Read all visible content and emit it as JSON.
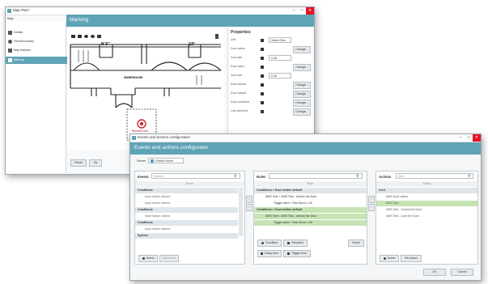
{
  "back_window": {
    "title": "Map Plan*",
    "menu": "Map",
    "sidebar": [
      {
        "label": "Details",
        "icon": "pencil-icon"
      },
      {
        "label": "Floor/Boundary",
        "icon": "people-icon"
      },
      {
        "label": "Map features",
        "icon": "car-icon"
      },
      {
        "label": "Marking",
        "icon": "marker-icon"
      }
    ],
    "active_sidebar": "Marking",
    "header": "Marking",
    "properties_title": "Properties",
    "floor_labels": {
      "dim1": "6'3\"",
      "dim2": "10'",
      "room": "WAREHOUSE"
    },
    "marker_label": "Receiver 000",
    "properties": [
      {
        "label": "Unit",
        "value": "World Ohm",
        "button": ""
      },
      {
        "label": "Door alarm",
        "value": "",
        "button": "Change..."
      },
      {
        "label": "Icon size",
        "value": "0.45",
        "button": ""
      },
      {
        "label": "Door open",
        "value": "",
        "button": "Change..."
      },
      {
        "label": "Icon size",
        "value": "0.45",
        "button": ""
      },
      {
        "label": "Door closed",
        "value": "",
        "button": "Change..."
      },
      {
        "label": "Door locked",
        "value": "",
        "button": "Change..."
      },
      {
        "label": "Door unlocked",
        "value": "",
        "button": "Change..."
      },
      {
        "label": "Link selected",
        "value": "",
        "button": "Change..."
      }
    ],
    "buttons": {
      "reset": "Reset",
      "ok": "Ok"
    }
  },
  "front_window": {
    "title": "Events and actions configuration",
    "header": "Events and actions configurator",
    "server_label": "Server",
    "server_value": "Global Server",
    "events": {
      "label": "Events",
      "placeholder": "System",
      "column": "Event",
      "items": [
        {
          "text": "Conditions",
          "type": "group"
        },
        {
          "text": "Input button clicked",
          "type": "item"
        },
        {
          "text": "Input button clicked",
          "type": "item"
        },
        {
          "text": "Conditions",
          "type": "group"
        },
        {
          "text": "Input button clicked",
          "type": "item"
        },
        {
          "text": "Conditions",
          "type": "group"
        },
        {
          "text": "Input button clicked",
          "type": "item"
        },
        {
          "text": "System",
          "type": "group"
        }
      ],
      "buttons": [
        "Select",
        "Add event"
      ]
    },
    "rules": {
      "label": "Rules",
      "column": "Rule",
      "items": [
        {
          "text": "Conditions > Door button default",
          "type": "group"
        },
        {
          "text": "AMS Test > AMS Test - Unlock the Door",
          "type": "item"
        },
        {
          "text": "Trigger alert > Test Show 1.00",
          "type": "sub"
        },
        {
          "text": "Conditions > Door button default",
          "type": "group-sel"
        },
        {
          "text": "AMS Test > AMS Test - Unlock the Door",
          "type": "item-sel"
        },
        {
          "text": "Trigger alert > Test Show 1.00",
          "type": "sub-sel"
        }
      ],
      "buttons": [
        "Condition",
        "Schedule",
        "Reset",
        "Delay time",
        "Trigger time"
      ]
    },
    "actions": {
      "label": "Actions",
      "placeholder": "Alert",
      "column": "Action",
      "items": [
        {
          "text": "Alert",
          "type": "group"
        },
        {
          "text": "AMS Door action",
          "type": "item"
        },
        {
          "text": "AMS Test",
          "type": "sel"
        },
        {
          "text": "AMS Test - Unlock the Door",
          "type": "item"
        },
        {
          "text": "AMS Test - Lock the Door",
          "type": "item"
        }
      ],
      "buttons": [
        "Select",
        "Set action"
      ]
    },
    "footer": {
      "ok": "OK",
      "cancel": "Cancel"
    }
  }
}
